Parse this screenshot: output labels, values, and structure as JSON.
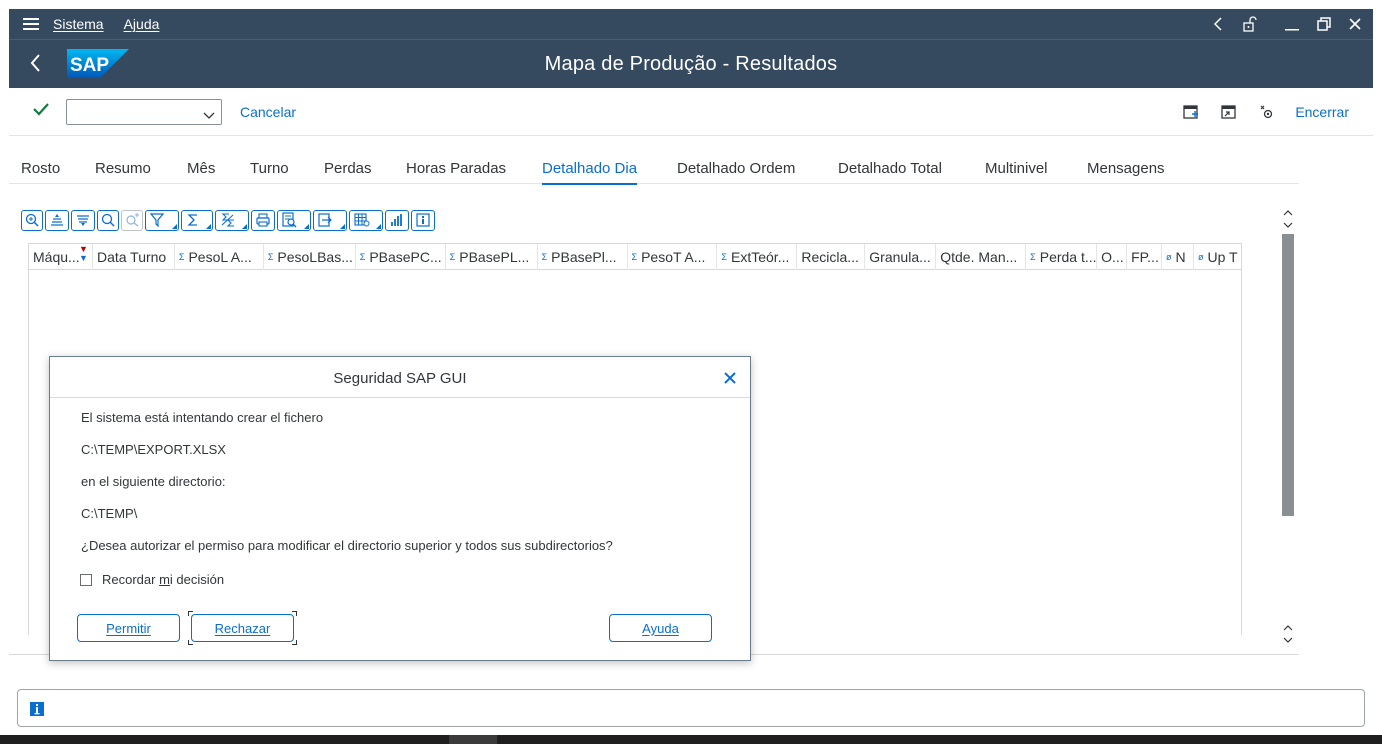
{
  "menu": {
    "items": [
      "Sistema",
      "Ajuda"
    ]
  },
  "title": {
    "text": "Mapa de Produção - Resultados",
    "logo": "SAP"
  },
  "toolbar": {
    "command_value": "",
    "cancel_label": "Cancelar",
    "exit_label": "Encerrar"
  },
  "tabs": [
    {
      "label": "Rosto"
    },
    {
      "label": "Resumo"
    },
    {
      "label": "Mês"
    },
    {
      "label": "Turno"
    },
    {
      "label": "Perdas"
    },
    {
      "label": "Horas Paradas"
    },
    {
      "label": "Detalhado Dia",
      "active": true
    },
    {
      "label": "Detalhado Ordem"
    },
    {
      "label": "Detalhado Total"
    },
    {
      "label": "Multinivel"
    },
    {
      "label": "Mensagens"
    }
  ],
  "grid": {
    "columns": [
      {
        "label": "Máqu...",
        "sorted": true
      },
      {
        "label": "Data Turno"
      },
      {
        "label": "PesoL A...",
        "sigma": "Σ"
      },
      {
        "label": "PesoLBas...",
        "sigma": "Σ"
      },
      {
        "label": "PBasePC...",
        "sigma": "Σ"
      },
      {
        "label": "PBasePL...",
        "sigma": "Σ"
      },
      {
        "label": "PBasePl...",
        "sigma": "Σ"
      },
      {
        "label": "PesoT A...",
        "sigma": "Σ"
      },
      {
        "label": "ExtTeór...",
        "sigma": "Σ"
      },
      {
        "label": "Recicla..."
      },
      {
        "label": "Granula..."
      },
      {
        "label": "Qtde. Man..."
      },
      {
        "label": "Perda t...",
        "sigma": "Σ"
      },
      {
        "label": "O..."
      },
      {
        "label": "FP..."
      },
      {
        "label": "N",
        "sigma": "ø"
      },
      {
        "label": "Up T",
        "sigma": "ø"
      }
    ]
  },
  "dialog": {
    "title": "Seguridad SAP GUI",
    "line1": "El sistema está intentando crear el fichero",
    "line2": "C:\\TEMP\\EXPORT.XLSX",
    "line3": "en el siguiente directorio:",
    "line4": "C:\\TEMP\\",
    "line5": "¿Desea autorizar el permiso para modificar el directorio superior y todos sus subdirectorios?",
    "remember_pre": "Recordar ",
    "remember_key": "m",
    "remember_post": "i decisión",
    "allow_label": "Permitir",
    "reject_label": "Rechazar",
    "help_label": "Ayuda"
  },
  "colors": {
    "shell": "#354a5f",
    "accent": "#0a6ed1",
    "text": "#32363a"
  }
}
